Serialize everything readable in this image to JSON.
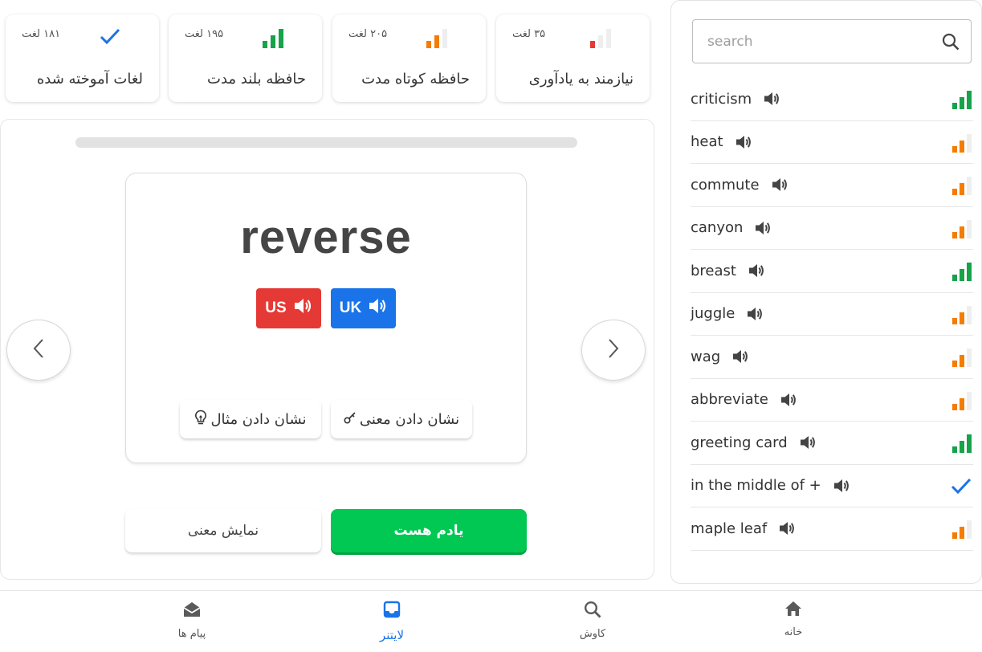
{
  "stats": [
    {
      "count": "۱۸۱ لغت",
      "label": "لغات آموخته شده",
      "icon": "check-icon"
    },
    {
      "count": "۱۹۵ لغت",
      "label": "حافظه بلند مدت",
      "icon": "signal-high-icon"
    },
    {
      "count": "۲۰۵ لغت",
      "label": "حافظه کوتاه مدت",
      "icon": "signal-medium-icon"
    },
    {
      "count": "۳۵ لغت",
      "label": "نیازمند به یادآوری",
      "icon": "signal-low-icon"
    }
  ],
  "card": {
    "word": "reverse",
    "us_label": "US",
    "uk_label": "UK",
    "show_meaning_hint": "نشان دادن معنی",
    "show_example_hint": "نشان دادن مثال"
  },
  "actions": {
    "know": "یادم هست",
    "show_meaning": "نمایش معنی"
  },
  "search": {
    "placeholder": "search"
  },
  "words": [
    {
      "text": "criticism",
      "level": "high"
    },
    {
      "text": "heat",
      "level": "medium"
    },
    {
      "text": "commute",
      "level": "medium"
    },
    {
      "text": "canyon",
      "level": "medium"
    },
    {
      "text": "breast",
      "level": "high"
    },
    {
      "text": "juggle",
      "level": "medium"
    },
    {
      "text": "wag",
      "level": "medium"
    },
    {
      "text": "abbreviate",
      "level": "medium"
    },
    {
      "text": "greeting card",
      "level": "high"
    },
    {
      "text": "in the middle of +",
      "level": "learned"
    },
    {
      "text": "maple leaf",
      "level": "medium"
    }
  ],
  "bottom_nav": [
    {
      "label": "پیام ها",
      "icon": "mail-open-icon"
    },
    {
      "label": "لایتنر",
      "icon": "inbox-icon",
      "active": true
    },
    {
      "label": "کاوش",
      "icon": "search-icon"
    },
    {
      "label": "خانه",
      "icon": "home-icon"
    }
  ],
  "colors": {
    "green": "#16a34a",
    "orange": "#f57c00",
    "red": "#e53935",
    "blue": "#1a73e8",
    "know_button": "#00c853"
  }
}
